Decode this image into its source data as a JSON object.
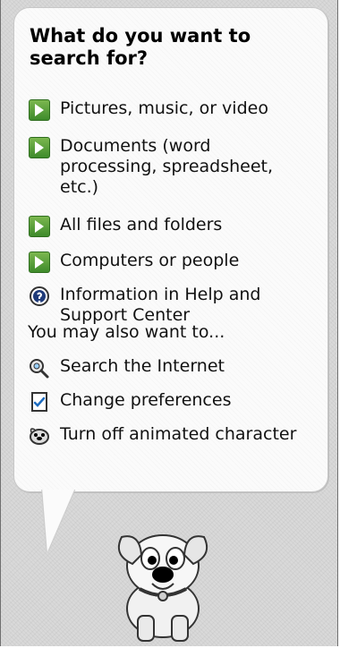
{
  "panel": {
    "title": "What do you want to search for?",
    "options": [
      {
        "label": "Pictures, music, or video",
        "icon": "green-arrow-icon"
      },
      {
        "label": "Documents (word processing, spreadsheet, etc.)",
        "icon": "green-arrow-icon"
      },
      {
        "label": "All files and folders",
        "icon": "green-arrow-icon"
      },
      {
        "label": "Computers or people",
        "icon": "green-arrow-icon"
      },
      {
        "label": "Information in Help and Support Center",
        "icon": "help-icon"
      }
    ],
    "also_heading": "You may also want to...",
    "also_options": [
      {
        "label": "Search the Internet",
        "icon": "search-internet-icon"
      },
      {
        "label": "Change preferences",
        "icon": "preferences-icon"
      },
      {
        "label": "Turn off animated character",
        "icon": "dog-icon"
      }
    ]
  }
}
